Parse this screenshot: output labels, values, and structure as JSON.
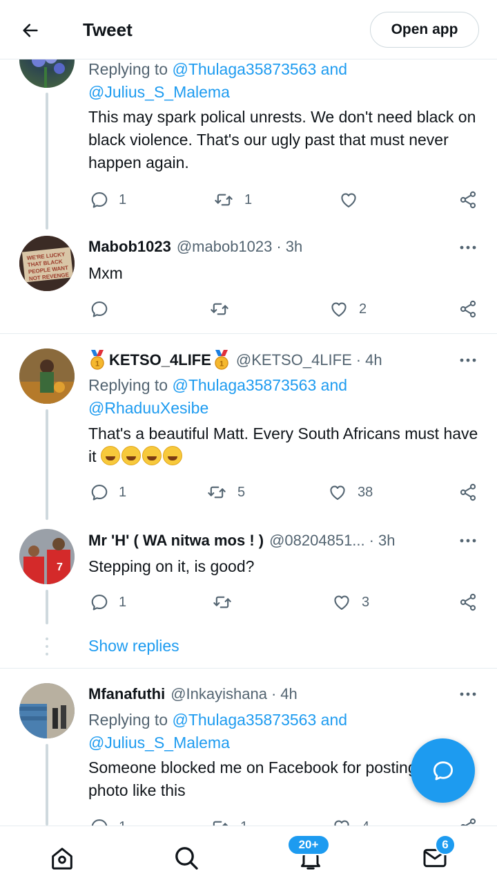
{
  "header": {
    "title": "Tweet",
    "open_app_label": "Open app"
  },
  "tweets": [
    {
      "reply_prefix": "Replying to",
      "reply_mention_1": "@Thulaga35873563",
      "reply_and": "and",
      "reply_mention_2": "@Julius_S_Malema",
      "text": "This may spark polical unrests. We don't need black on black violence. That's our ugly past that must never happen again.",
      "replies": "1",
      "retweets": "1",
      "likes": ""
    },
    {
      "name": "Mabob1023",
      "handle": "@mabob1023",
      "dot": "·",
      "time": "3h",
      "text": "Mxm",
      "replies": "",
      "retweets": "",
      "likes": "2"
    },
    {
      "name": "KETSO_4LIFE",
      "handle": "@KETSO_4LIFE",
      "dot": "·",
      "time": "4h",
      "reply_prefix": "Replying to",
      "reply_mention_1": "@Thulaga35873563",
      "reply_and": "and",
      "reply_mention_2": "@RhaduuXesibe",
      "text": "That's a beautiful Matt. Every South Africans must have it",
      "replies": "1",
      "retweets": "5",
      "likes": "38"
    },
    {
      "name": "Mr 'H' ( WA nitwa mos ! )",
      "handle": "@08204851...",
      "dot": "·",
      "time": "3h",
      "text": "Stepping on it, is good?",
      "replies": "1",
      "retweets": "",
      "likes": "3"
    },
    {
      "name": "Mfanafuthi",
      "handle": "@Inkayishana",
      "dot": "·",
      "time": "4h",
      "reply_prefix": "Replying to",
      "reply_mention_1": "@Thulaga35873563",
      "reply_and": "and",
      "reply_mention_2": "@Julius_S_Malema",
      "text": "Someone blocked me on Facebook for posting photo like this",
      "replies": "1",
      "retweets": "1",
      "likes": "4"
    }
  ],
  "show_replies": "Show replies",
  "bottom_nav": {
    "notifications_badge": "20+",
    "messages_badge": "6"
  },
  "colors": {
    "accent": "#1d9bf0",
    "text": "#0f1419",
    "secondary": "#536471",
    "divider": "#e6ecf0"
  },
  "icons": [
    "back-arrow-icon",
    "more-icon",
    "reply-icon",
    "retweet-icon",
    "like-icon",
    "share-icon",
    "compose-icon",
    "home-icon",
    "search-icon",
    "bell-icon",
    "mail-icon",
    "medal-icon",
    "rofl-emoji-icon"
  ]
}
